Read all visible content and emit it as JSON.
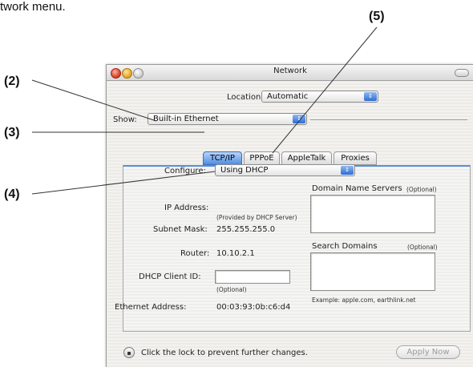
{
  "intro_text": "twork menu.",
  "callouts": [
    "(5)",
    "(2)",
    "(3)",
    "(4)"
  ],
  "window": {
    "title": "Network",
    "location_label": "Location:",
    "location_value": "Automatic",
    "show_label": "Show:",
    "show_value": "Built-in Ethernet",
    "tabs": [
      "TCP/IP",
      "PPPoE",
      "AppleTalk",
      "Proxies"
    ],
    "active_tab": "TCP/IP",
    "configure_label": "Configure:",
    "configure_value": "Using DHCP",
    "ip_label": "IP Address:",
    "ip_note": "(Provided by DHCP Server)",
    "subnet_label": "Subnet Mask:",
    "subnet_value": "255.255.255.0",
    "router_label": "Router:",
    "router_value": "10.10.2.1",
    "dhcp_label": "DHCP Client ID:",
    "dhcp_value": "",
    "dhcp_optional": "(Optional)",
    "ethernet_label": "Ethernet Address:",
    "ethernet_value": "00:03:93:0b:c6:d4",
    "dns_label": "Domain Name Servers",
    "dns_optional": "(Optional)",
    "dns_value": "",
    "search_label": "Search Domains",
    "search_optional": "(Optional)",
    "search_value": "",
    "example_text": "Example: apple.com, earthlink.net",
    "lock_text": "Click the lock to prevent further changes.",
    "apply_label": "Apply Now"
  }
}
